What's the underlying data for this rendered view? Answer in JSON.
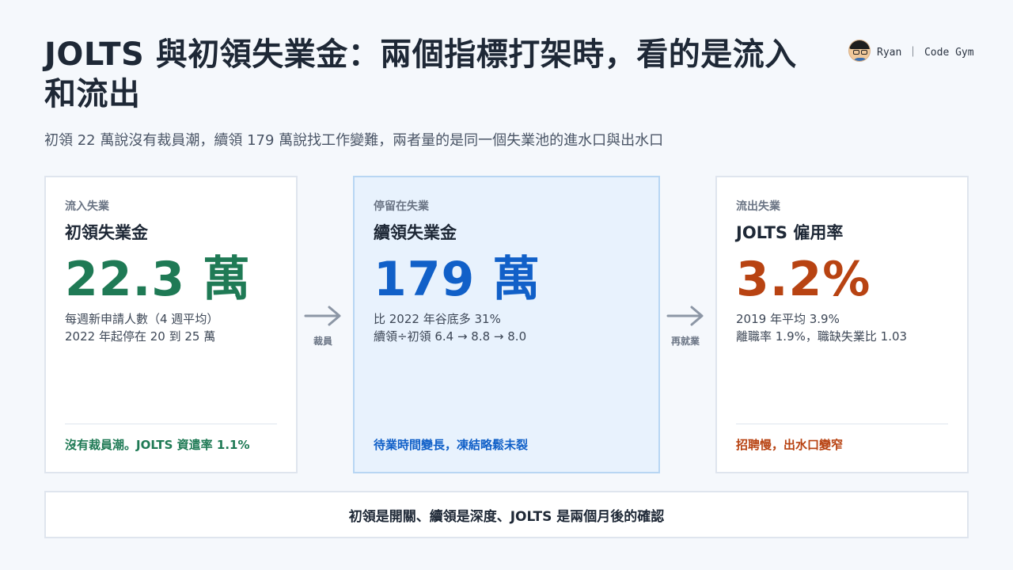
{
  "title": "JOLTS 與初領失業金：兩個指標打架時，看的是流入和流出",
  "brand": {
    "name": "Ryan ｜ Code Gym"
  },
  "subtitle": "初領 22 萬說沒有裁員潮，續領 179 萬說找工作變難，兩者量的是同一個失業池的進水口與出水口",
  "cards": [
    {
      "kicker": "流入失業",
      "title": "初領失業金",
      "value": "22.3 萬",
      "notes": [
        "每週新申請人數（4 週平均）",
        "2022 年起停在 20 到 25 萬"
      ],
      "footer": "沒有裁員潮。JOLTS 資遣率 1.1%"
    },
    {
      "kicker": "停留在失業",
      "title": "續領失業金",
      "value": "179 萬",
      "notes": [
        "比 2022 年谷底多 31%",
        "續領÷初領 6.4 → 8.8 → 8.0"
      ],
      "footer": "待業時間變長，凍結略鬆未裂"
    },
    {
      "kicker": "流出失業",
      "title": "JOLTS 僱用率",
      "value": "3.2%",
      "notes": [
        "2019 年平均 3.9%",
        "離職率 1.9%，職缺失業比 1.03"
      ],
      "footer": "招聘慢，出水口變窄"
    }
  ],
  "arrows": [
    {
      "label": "裁員",
      "icon": "arrow-right-icon"
    },
    {
      "label": "再就業",
      "icon": "arrow-right-icon"
    }
  ],
  "bottom": "初領是開關、續領是深度、JOLTS 是兩個月後的確認",
  "colors": {
    "inflow": "#1f7a55",
    "stock": "#1160c8",
    "outflow": "#b84312",
    "background": "#f5f8fc"
  }
}
